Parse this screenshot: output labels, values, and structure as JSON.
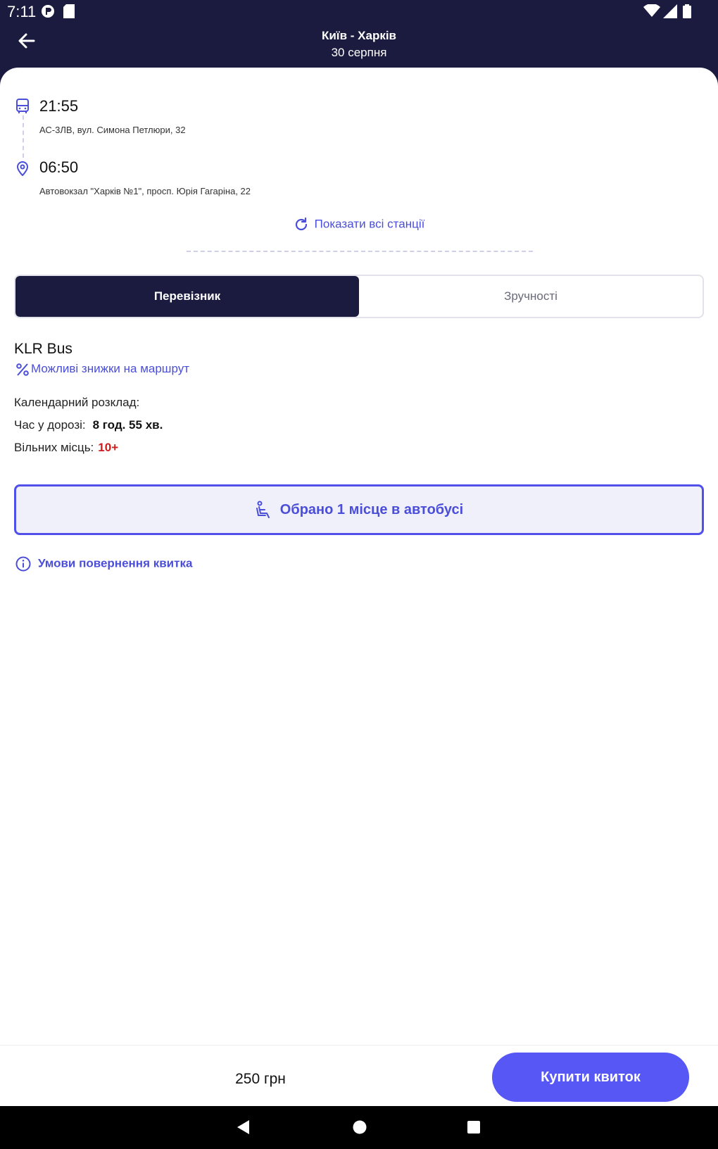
{
  "status": {
    "time": "7:11"
  },
  "header": {
    "route": "Київ - Харків",
    "date": "30 серпня"
  },
  "trip": {
    "departure": {
      "time": "21:55",
      "address": "АС-3ЛВ, вул. Симона Петлюри, 32"
    },
    "arrival": {
      "time": "06:50",
      "address": "Автовокзал \"Харків №1\", просп. Юрія Гагаріна, 22"
    },
    "show_all_label": "Показати всі станції"
  },
  "tabs": [
    {
      "label": "Перевізник",
      "active": true
    },
    {
      "label": "Зручності",
      "active": false
    }
  ],
  "carrier": {
    "name": "KLR Bus",
    "discount_label": "Можливі знижки на маршрут",
    "schedule_label": "Календарний розклад:",
    "duration_label": "Час у дорозі:",
    "duration_value": "8 год. 55 хв.",
    "seats_label": "Вільних місць:",
    "seats_value": "10+"
  },
  "seat_selection_label": "Обрано 1 місце в автобусі",
  "refund_label": "Умови повернення квитка",
  "footer": {
    "price": "250 грн",
    "buy_label": "Купити квиток"
  },
  "colors": {
    "header_bg": "#1b1b3f",
    "accent": "#4a4ed8",
    "buy_button": "#5657f5",
    "seats_value": "#d01a1a"
  },
  "icons": [
    "back-arrow-icon",
    "bus-icon",
    "location-pin-icon",
    "refresh-icon",
    "percent-icon",
    "seat-icon",
    "info-icon"
  ]
}
